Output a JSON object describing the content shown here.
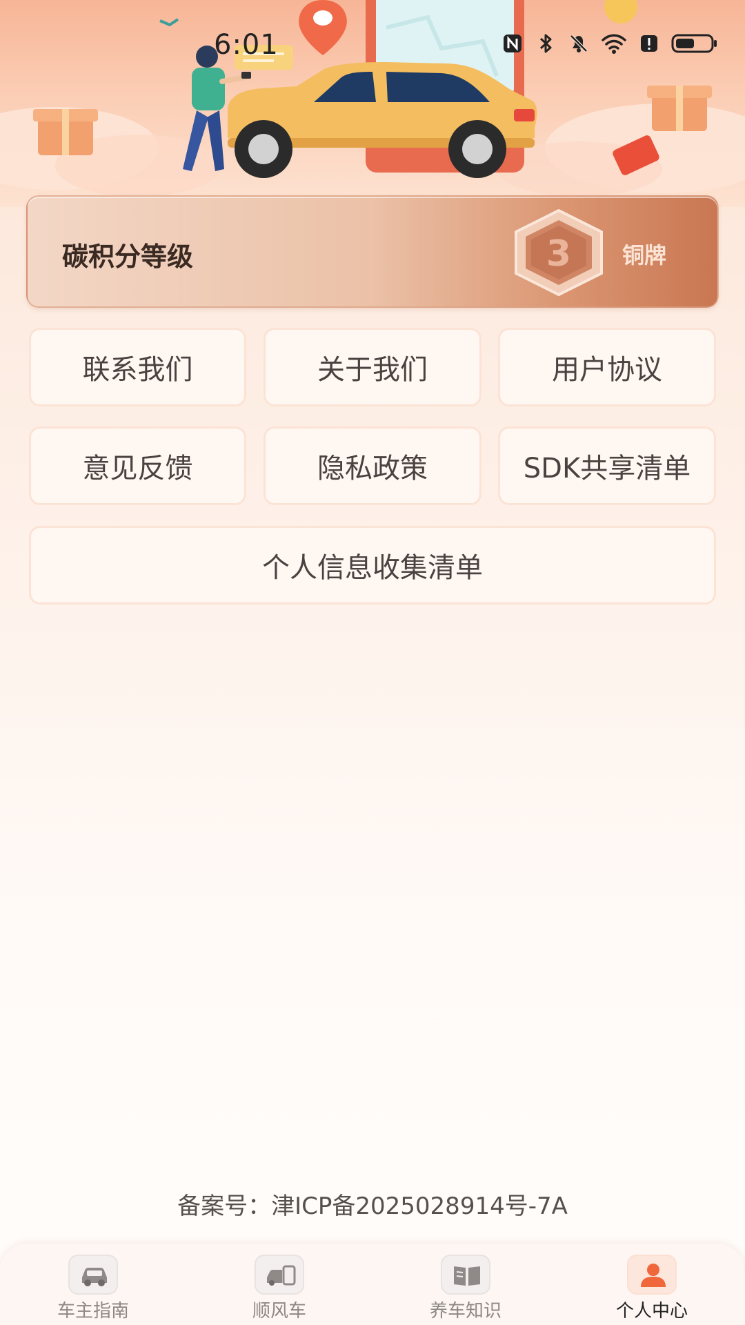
{
  "status_bar": {
    "time": "6:01"
  },
  "carbon_card": {
    "title": "碳积分等级",
    "badge_icon": "bronze-medal-icon",
    "badge_label": "铜牌"
  },
  "menu": {
    "contact": "联系我们",
    "about": "关于我们",
    "agreement": "用户协议",
    "feedback": "意见反馈",
    "privacy": "隐私政策",
    "sdk": "SDK共享清单",
    "personal_info": "个人信息收集清单"
  },
  "footer": {
    "icp": "备案号：津ICP备2025028914号-7A"
  },
  "tabs": [
    {
      "label": "车主指南",
      "icon": "car-icon"
    },
    {
      "label": "顺风车",
      "icon": "carpool-icon"
    },
    {
      "label": "养车知识",
      "icon": "book-icon"
    },
    {
      "label": "个人中心",
      "icon": "person-icon"
    }
  ],
  "active_tab": "个人中心",
  "colors": {
    "accent": "#f0673b",
    "card_end": "#c97752",
    "background_top": "#fde3d2"
  }
}
